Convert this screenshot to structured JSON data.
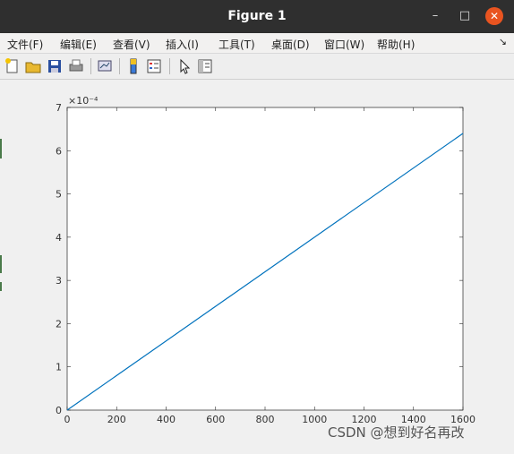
{
  "window": {
    "title": "Figure 1",
    "controls": {
      "minimize": "–",
      "maximize": "□",
      "close": "✕"
    }
  },
  "menu": {
    "items": [
      "文件(F)",
      "编辑(E)",
      "查看(V)",
      "插入(I)",
      "工具(T)",
      "桌面(D)",
      "窗口(W)",
      "帮助(H)"
    ],
    "overflow_arrow": "↘"
  },
  "toolbar": {
    "buttons": [
      "new-figure-icon",
      "open-file-icon",
      "save-icon",
      "print-icon",
      "link-plot-icon",
      "insert-colorbar-icon",
      "insert-legend-icon",
      "pointer-icon",
      "property-inspector-icon"
    ]
  },
  "chart_data": {
    "type": "line",
    "title": "",
    "xlabel": "",
    "ylabel": "",
    "exponent_label": "×10⁻⁴",
    "xlim": [
      0,
      1600
    ],
    "ylim": [
      0,
      7
    ],
    "xticks": [
      "0",
      "200",
      "400",
      "600",
      "800",
      "1000",
      "1200",
      "1400",
      "1600"
    ],
    "yticks": [
      "0",
      "1",
      "2",
      "3",
      "4",
      "5",
      "6",
      "7"
    ],
    "series": [
      {
        "color": "#0072bd",
        "x": [
          0,
          1600
        ],
        "y": [
          0,
          6.4
        ]
      }
    ],
    "grid": false,
    "legend": "none"
  },
  "watermark": "CSDN @想到好名再改"
}
